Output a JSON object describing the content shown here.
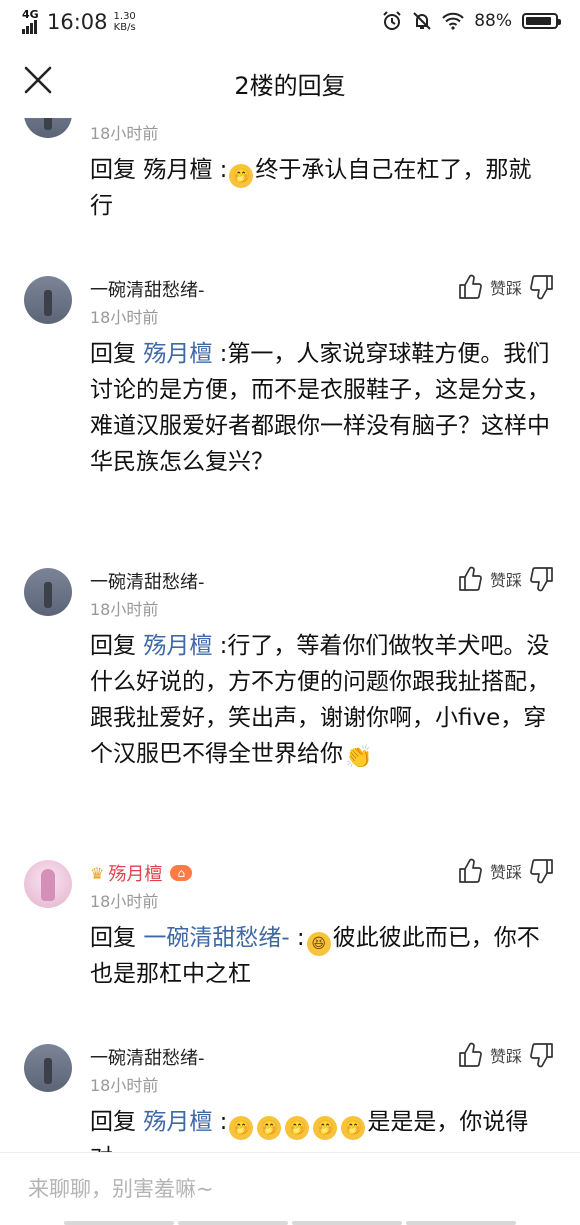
{
  "status_bar": {
    "network": "4G",
    "time": "16:08",
    "speed_value": "1.30",
    "speed_unit": "KB/s",
    "battery": "88%",
    "battery_level": 0.88
  },
  "header": {
    "title": "2楼的回复"
  },
  "comments": [
    {
      "time": "18小时前",
      "reply_prefix": "回复 ",
      "mention": "殇月檀",
      "sep": " :",
      "text": "终于承认自己在杠了，那就行"
    },
    {
      "username": "一碗清甜愁绪-",
      "time": "18小时前",
      "reply_prefix": "回复 ",
      "mention": "殇月檀",
      "sep": "  :",
      "text": "第一，人家说穿球鞋方便。我们讨论的是方便，而不是衣服鞋子，这是分支，难道汉服爱好者都跟你一样没有脑子？这样中华民族怎么复兴？",
      "zan_label": "赞踩"
    },
    {
      "username": "一碗清甜愁绪-",
      "time": "18小时前",
      "reply_prefix": "回复 ",
      "mention": "殇月檀",
      "sep": "  :",
      "text": "行了，等着你们做牧羊犬吧。没什么好说的，方不方便的问题你跟我扯搭配，跟我扯爱好，笑出声，谢谢你啊，小five，穿个汉服巴不得全世界给你",
      "zan_label": "赞踩"
    },
    {
      "username": "殇月檀",
      "time": "18小时前",
      "reply_prefix": "回复 ",
      "mention": "一碗清甜愁绪-",
      "sep": " :",
      "text": "彼此彼此而已，你不也是那杠中之杠",
      "zan_label": "赞踩"
    },
    {
      "username": "一碗清甜愁绪-",
      "time": "18小时前",
      "reply_prefix": "回复 ",
      "mention": "殇月檀",
      "sep": "  :",
      "text": "是是是，你说得对",
      "zan_label": "赞踩"
    }
  ],
  "footer": {
    "placeholder": "来聊聊，别害羞嘛~"
  },
  "icons": {
    "emoji": "face-hand-over-mouth-emoji",
    "emoji_grin": "grinning-squinting-face-emoji",
    "emoji_clap": "clapping-hands-emoji"
  }
}
